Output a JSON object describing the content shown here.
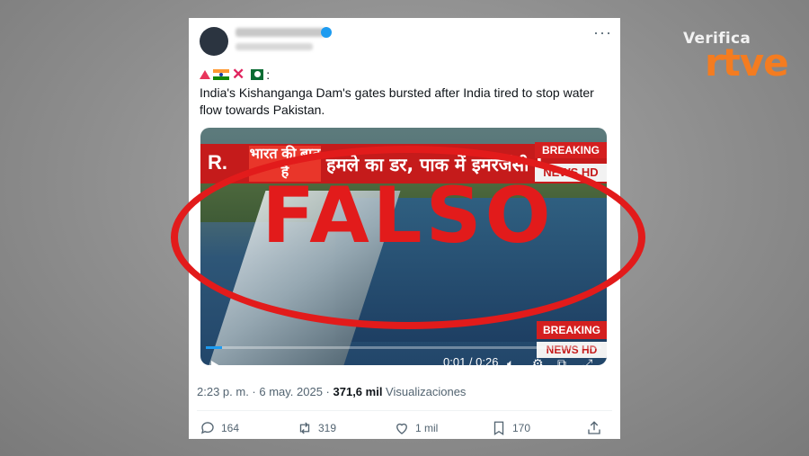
{
  "brand": {
    "top": "Verifica",
    "main": "rtve"
  },
  "tweet": {
    "text": "India's Kishanganga Dam's gates bursted after India tired to stop water flow towards Pakistan.",
    "video": {
      "channel_logo": "R.",
      "show_title": "भारत की बात है",
      "headline": "हमले का डर, पाक में इमरजेंसी !",
      "tag_breaking": "BREAKING",
      "tag_news": "NEWS HD",
      "time": "0:01 / 0:26",
      "progress": 0.04
    },
    "stamp": "FALSO",
    "timestamp": "2:23 p. m. · 6 may. 2025 · ",
    "views_value": "371,6 mil",
    "views_label": " Visualizaciones",
    "actions": {
      "replies": "164",
      "reposts": "319",
      "likes": "1 mil",
      "bookmarks": "170"
    }
  },
  "colors": {
    "accent": "#e21b1b",
    "brand": "#f47c20",
    "verified": "#1d9bf0"
  }
}
